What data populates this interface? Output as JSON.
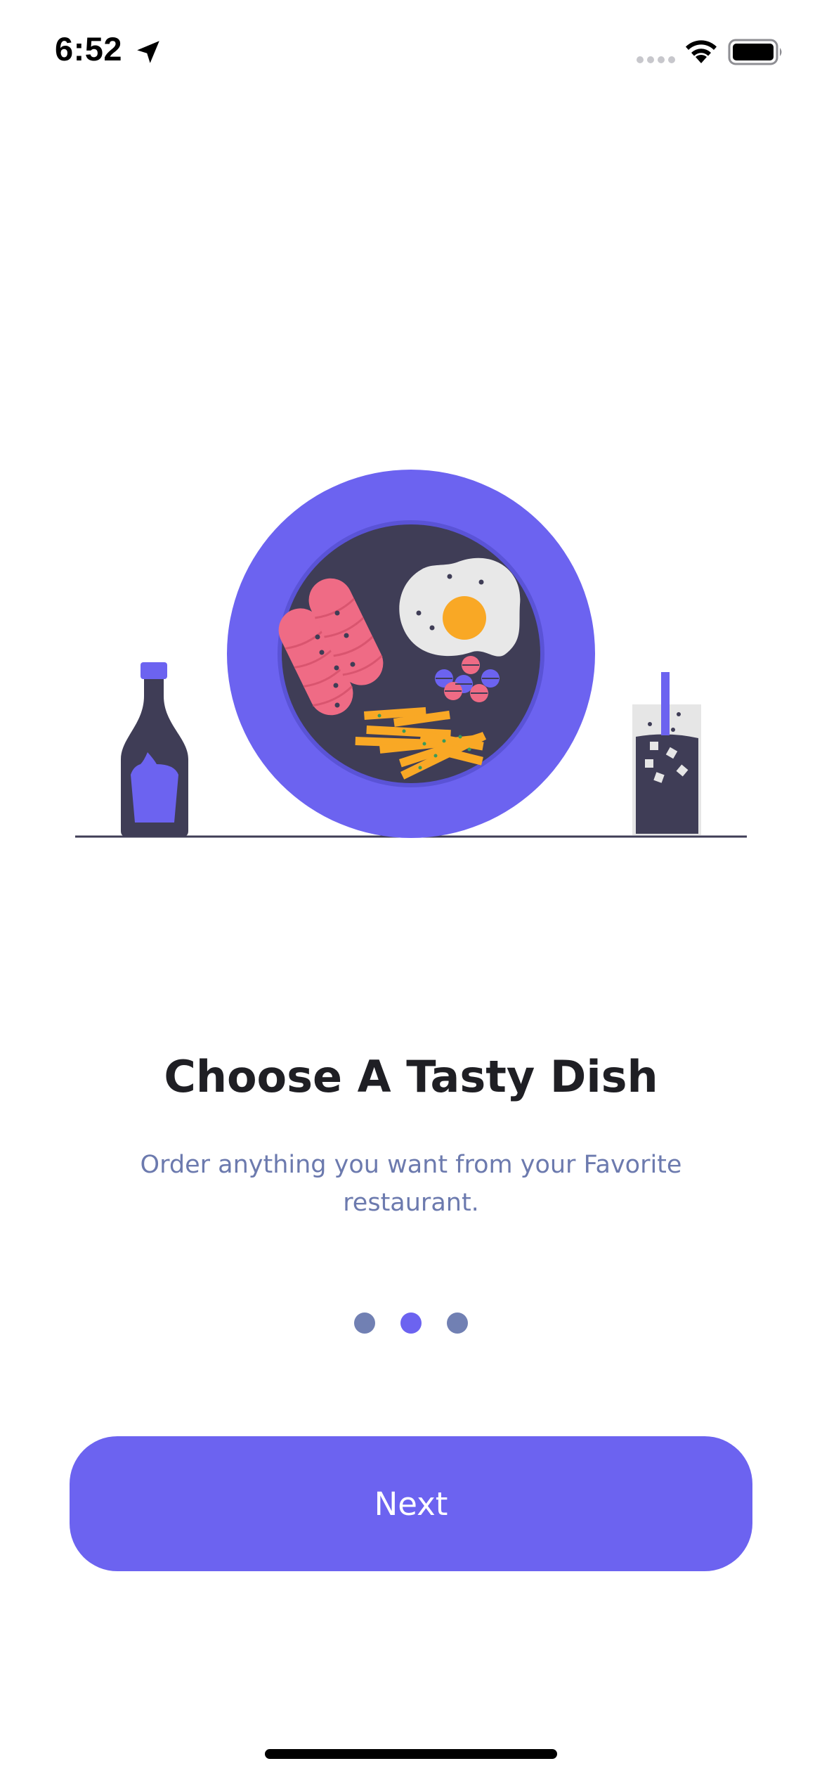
{
  "status_bar": {
    "time": "6:52"
  },
  "onboarding": {
    "title": "Choose A Tasty Dish",
    "subtitle": "Order anything you want from your Favorite restaurant.",
    "current_page": 2,
    "page_count": 3
  },
  "actions": {
    "next_label": "Next"
  },
  "colors": {
    "accent": "#6c63f0",
    "dark": "#3f3d56",
    "sausage": "#ef6b85",
    "fries": "#f9a825",
    "subtitle": "#6c7aae",
    "inactive_dot": "#7180b3"
  }
}
